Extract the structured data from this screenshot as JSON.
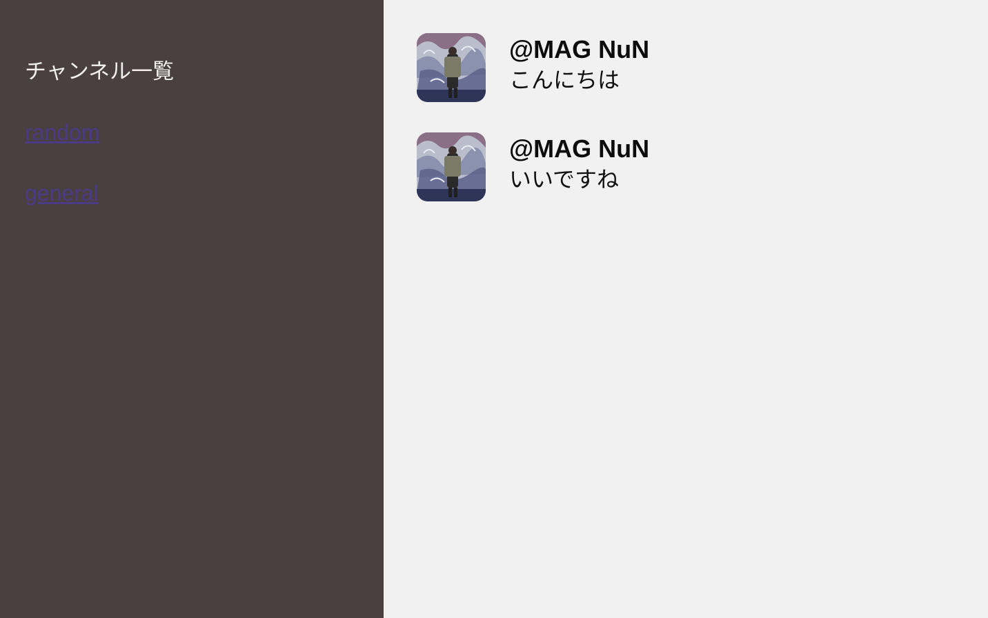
{
  "sidebar": {
    "title": "チャンネル一覧",
    "channels": [
      {
        "label": "random"
      },
      {
        "label": "general"
      }
    ]
  },
  "messages": [
    {
      "user": "@MAG NuN",
      "text": "こんにちは"
    },
    {
      "user": "@MAG NuN",
      "text": "いいですね"
    }
  ],
  "colors": {
    "sidebar_bg": "#4a4040",
    "main_bg": "#f1f1f1",
    "link": "#4b3a85",
    "sidebar_text": "#f1efef"
  }
}
